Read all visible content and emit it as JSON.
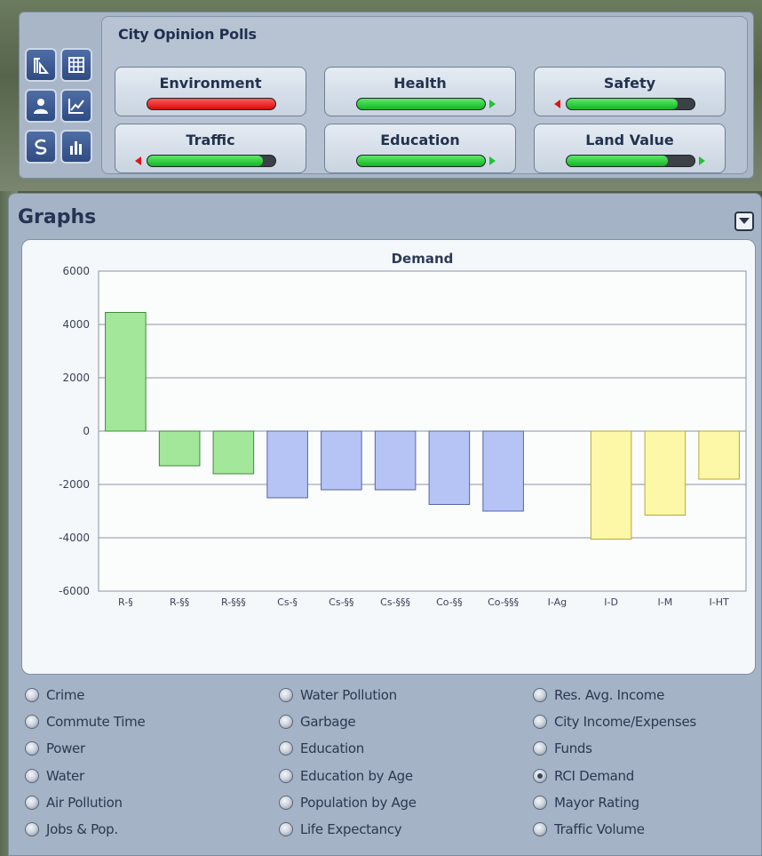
{
  "polls": {
    "title": "City Opinion Polls",
    "items": [
      {
        "label": "Environment",
        "level": 1.0,
        "color": "#e01616",
        "trend": "none"
      },
      {
        "label": "Health",
        "level": 1.0,
        "color": "#11b722",
        "trend": "up"
      },
      {
        "label": "Safety",
        "level": 0.87,
        "color": "#11b722",
        "trend": "down"
      },
      {
        "label": "Traffic",
        "level": 0.9,
        "color": "#11b722",
        "trend": "down"
      },
      {
        "label": "Education",
        "level": 1.0,
        "color": "#11b722",
        "trend": "up"
      },
      {
        "label": "Land Value",
        "level": 0.79,
        "color": "#11b722",
        "trend": "up"
      }
    ],
    "tools": [
      "zoning-icon",
      "grid-icon",
      "person-icon",
      "line-graph-icon",
      "swirl-icon",
      "bar-graph-icon"
    ]
  },
  "graphs": {
    "title": "Graphs",
    "collapse_icon": "chevron-down-icon",
    "options": [
      {
        "label": "Crime",
        "selected": false
      },
      {
        "label": "Commute Time",
        "selected": false
      },
      {
        "label": "Power",
        "selected": false
      },
      {
        "label": "Water",
        "selected": false
      },
      {
        "label": "Air Pollution",
        "selected": false
      },
      {
        "label": "Jobs & Pop.",
        "selected": false
      },
      {
        "label": "Water Pollution",
        "selected": false
      },
      {
        "label": "Garbage",
        "selected": false
      },
      {
        "label": "Education",
        "selected": false
      },
      {
        "label": "Education by Age",
        "selected": false
      },
      {
        "label": "Population by Age",
        "selected": false
      },
      {
        "label": "Life Expectancy",
        "selected": false
      },
      {
        "label": "Res. Avg. Income",
        "selected": false
      },
      {
        "label": "City Income/Expenses",
        "selected": false
      },
      {
        "label": "Funds",
        "selected": false
      },
      {
        "label": "RCI Demand",
        "selected": true
      },
      {
        "label": "Mayor Rating",
        "selected": false
      },
      {
        "label": "Traffic Volume",
        "selected": false
      }
    ]
  },
  "chart_data": {
    "type": "bar",
    "title": "Demand",
    "xlabel": "",
    "ylabel": "",
    "ylim": [
      -6000,
      6000
    ],
    "yticks": [
      6000,
      4000,
      2000,
      0,
      -2000,
      -4000,
      -6000
    ],
    "grid": true,
    "categories": [
      "R-§",
      "R-§§",
      "R-§§§",
      "Cs-§",
      "Cs-§§",
      "Cs-§§§",
      "Co-§§",
      "Co-§§§",
      "I-Ag",
      "I-D",
      "I-M",
      "I-HT"
    ],
    "values": [
      4450,
      -1300,
      -1600,
      -2500,
      -2200,
      -2200,
      -2750,
      -3000,
      0,
      -4050,
      -3150,
      -1800
    ],
    "colors": [
      "#a3e89a",
      "#a3e89a",
      "#a3e89a",
      "#b6c4f5",
      "#b6c4f5",
      "#b6c4f5",
      "#b6c4f5",
      "#b6c4f5",
      "#fdf7a8",
      "#fdf7a8",
      "#fdf7a8",
      "#fdf7a8"
    ],
    "strokes": [
      "#3f8a3a",
      "#3f8a3a",
      "#3f8a3a",
      "#5565a6",
      "#5565a6",
      "#5565a6",
      "#5565a6",
      "#5565a6",
      "#b8a93a",
      "#b8a93a",
      "#b8a93a",
      "#b8a93a"
    ]
  }
}
